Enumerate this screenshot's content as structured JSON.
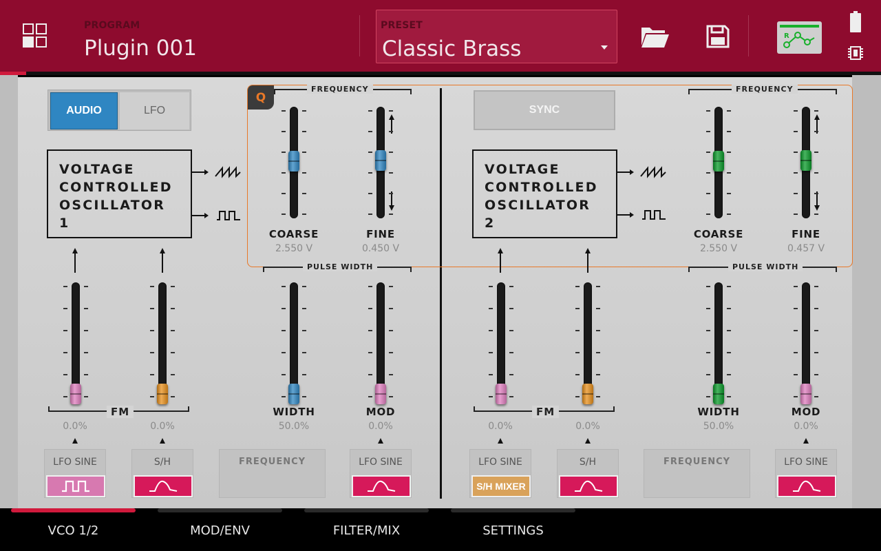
{
  "header": {
    "program_label": "PROGRAM",
    "program_name": "Plugin 001",
    "preset_label": "PRESET",
    "preset_name": "Classic Brass"
  },
  "vco1": {
    "mode_buttons": [
      "AUDIO",
      "LFO"
    ],
    "active_mode": "AUDIO",
    "title_lines": [
      "VOLTAGE",
      "CONTROLLED",
      "OSCILLATOR",
      "1"
    ],
    "frequency_label": "FREQUENCY",
    "pulse_width_label": "PULSE WIDTH",
    "q_badge": "Q",
    "coarse": {
      "label": "COARSE",
      "value": "2.550 V",
      "level": 0.55
    },
    "fine": {
      "label": "FINE",
      "value": "0.450 V",
      "level": 0.56
    },
    "fm_label": "FM",
    "fm1": {
      "value": "0.0%",
      "level": 0.0,
      "source": "LFO SINE",
      "color": "#e07fbf"
    },
    "fm2": {
      "value": "0.0%",
      "level": 0.0,
      "source": "S/H",
      "color": "#e8901c"
    },
    "width": {
      "label": "WIDTH",
      "value": "50.0%",
      "level": 0.0,
      "source": "FREQUENCY"
    },
    "mod": {
      "label": "MOD",
      "value": "0.0%",
      "level": 0.0,
      "source": "LFO SINE"
    }
  },
  "vco2": {
    "sync_label": "SYNC",
    "title_lines": [
      "VOLTAGE",
      "CONTROLLED",
      "OSCILLATOR",
      "2"
    ],
    "frequency_label": "FREQUENCY",
    "pulse_width_label": "PULSE WIDTH",
    "coarse": {
      "label": "COARSE",
      "value": "2.550 V",
      "level": 0.55
    },
    "fine": {
      "label": "FINE",
      "value": "0.457 V",
      "level": 0.56
    },
    "fm_label": "FM",
    "fm1": {
      "value": "0.0%",
      "level": 0.0,
      "source": "LFO SINE",
      "chip": "S/H MIXER"
    },
    "fm2": {
      "value": "0.0%",
      "level": 0.0,
      "source": "S/H"
    },
    "width": {
      "label": "WIDTH",
      "value": "50.0%",
      "level": 0.0,
      "source": "FREQUENCY"
    },
    "mod": {
      "label": "MOD",
      "value": "0.0%",
      "level": 0.0,
      "source": "LFO SINE"
    }
  },
  "tabs": [
    "VCO 1/2",
    "MOD/ENV",
    "FILTER/MIX",
    "SETTINGS"
  ],
  "active_tab": "VCO 1/2",
  "colors": {
    "header": "#8e0b2e",
    "accent_blue": "#2f86c2",
    "pink": "#e07fbf",
    "orange": "#e8901c",
    "green": "#0a9a2a",
    "magenta_chip": "#d6195a",
    "pink_chip": "#d779b0",
    "tan_chip": "#d9a25a",
    "q_orange": "#e87828"
  }
}
